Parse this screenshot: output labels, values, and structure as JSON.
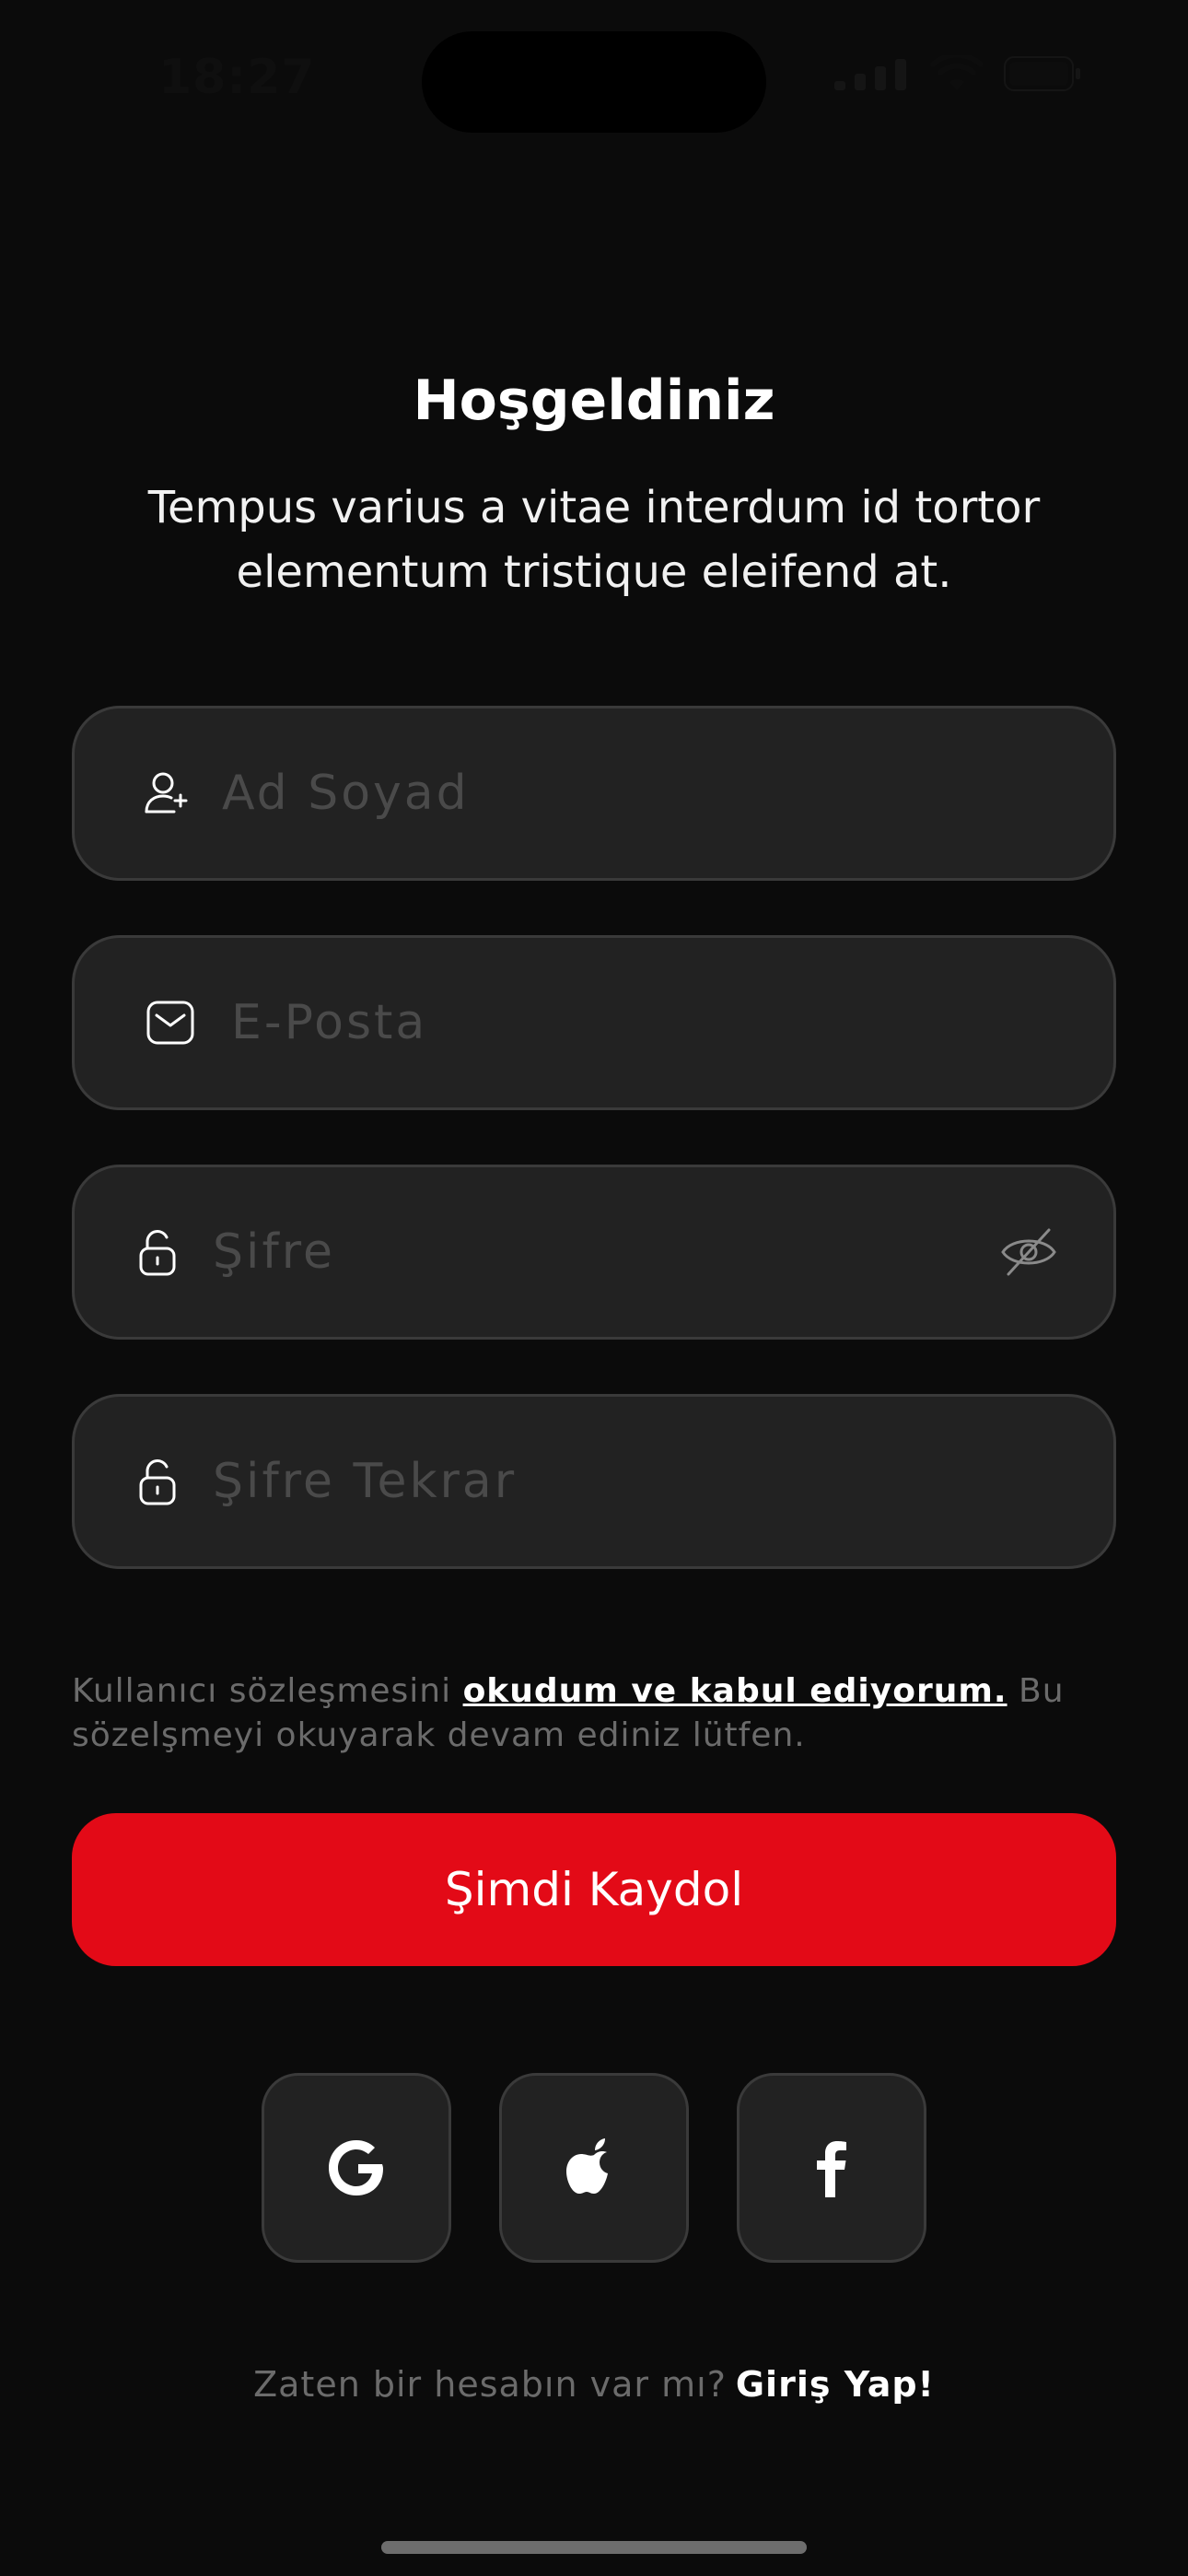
{
  "status_bar": {
    "time": "18:27"
  },
  "header": {
    "title": "Hoşgeldiniz",
    "subtitle": "Tempus varius a vitae interdum id tortor elementum tristique eleifend at."
  },
  "form": {
    "name_placeholder": "Ad Soyad",
    "email_placeholder": "E-Posta",
    "password_placeholder": "Şifre",
    "password_repeat_placeholder": "Şifre Tekrar"
  },
  "agreement": {
    "prefix": "Kullanıcı sözleşmesini ",
    "link": "okudum ve kabul ediyorum.",
    "suffix": " Bu sözelşmeyi okuyarak devam ediniz lütfen."
  },
  "primary_button": {
    "label": "Şimdi Kaydol",
    "color": "#e30a17"
  },
  "social": [
    "google-icon",
    "apple-icon",
    "facebook-icon"
  ],
  "footer": {
    "prompt": "Zaten bir hesabın var mı?",
    "link": "Giriş Yap!"
  }
}
